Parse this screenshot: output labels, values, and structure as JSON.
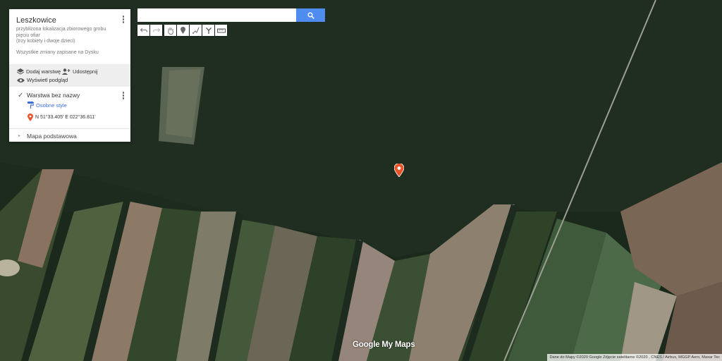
{
  "panel": {
    "title": "Leszkowice",
    "description": "przybliżona lokalizacja zbiorowego grobu\npięciu ofiar\n(trzy kobiety i dwoje dzieci)",
    "saved_status": "Wszystkie zmiany zapisane na Dysku",
    "actions": {
      "add_layer": "Dodaj warstwę",
      "share": "Udostępnij",
      "preview": "Wyświetl podgląd"
    },
    "layer": {
      "name": "Warstwa bez nazwy",
      "style_link": "Osobne style",
      "point_label": "N 51°33.405' E 022°36.811'"
    },
    "base_map": "Mapa podstawowa"
  },
  "search": {
    "placeholder": "",
    "value": ""
  },
  "toolbar": {
    "icons": [
      "undo-icon",
      "redo-icon",
      "hand-icon",
      "marker-icon",
      "draw-line-icon",
      "directions-icon",
      "ruler-icon"
    ]
  },
  "map": {
    "logo": "Google My Maps",
    "attribution": "Dane do Mapy ©2020 Google Zdjęcie satelitarne ©2020 , CNES / Airbus, MGGP Aero, Maxar Tec",
    "marker_color": "#e8542a",
    "accent_color": "#4e8cf0"
  }
}
